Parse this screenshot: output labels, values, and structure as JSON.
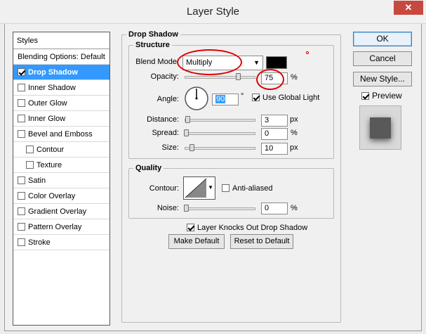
{
  "window": {
    "title": "Layer Style",
    "close_label": "✕"
  },
  "styles_list": {
    "header": "Styles",
    "items": [
      {
        "label": "Blending Options: Default",
        "checkbox": false,
        "checked": false,
        "sub": false,
        "selected": false
      },
      {
        "label": "Drop Shadow",
        "checkbox": true,
        "checked": true,
        "sub": false,
        "selected": true
      },
      {
        "label": "Inner Shadow",
        "checkbox": true,
        "checked": false,
        "sub": false,
        "selected": false
      },
      {
        "label": "Outer Glow",
        "checkbox": true,
        "checked": false,
        "sub": false,
        "selected": false
      },
      {
        "label": "Inner Glow",
        "checkbox": true,
        "checked": false,
        "sub": false,
        "selected": false
      },
      {
        "label": "Bevel and Emboss",
        "checkbox": true,
        "checked": false,
        "sub": false,
        "selected": false
      },
      {
        "label": "Contour",
        "checkbox": true,
        "checked": false,
        "sub": true,
        "selected": false
      },
      {
        "label": "Texture",
        "checkbox": true,
        "checked": false,
        "sub": true,
        "selected": false
      },
      {
        "label": "Satin",
        "checkbox": true,
        "checked": false,
        "sub": false,
        "selected": false
      },
      {
        "label": "Color Overlay",
        "checkbox": true,
        "checked": false,
        "sub": false,
        "selected": false
      },
      {
        "label": "Gradient Overlay",
        "checkbox": true,
        "checked": false,
        "sub": false,
        "selected": false
      },
      {
        "label": "Pattern Overlay",
        "checkbox": true,
        "checked": false,
        "sub": false,
        "selected": false
      },
      {
        "label": "Stroke",
        "checkbox": true,
        "checked": false,
        "sub": false,
        "selected": false
      }
    ]
  },
  "drop_shadow": {
    "title": "Drop Shadow",
    "structure": {
      "title": "Structure",
      "blend_mode_label": "Blend Mode:",
      "blend_mode_value": "Multiply",
      "shadow_color": "#000000",
      "opacity_label": "Opacity:",
      "opacity_value": "75",
      "opacity_unit": "%",
      "angle_label": "Angle:",
      "angle_value": "90",
      "angle_unit": "°",
      "use_global_light_label": "Use Global Light",
      "use_global_light_checked": true,
      "distance_label": "Distance:",
      "distance_value": "3",
      "distance_unit": "px",
      "spread_label": "Spread:",
      "spread_value": "0",
      "spread_unit": "%",
      "size_label": "Size:",
      "size_value": "10",
      "size_unit": "px"
    },
    "quality": {
      "title": "Quality",
      "contour_label": "Contour:",
      "anti_aliased_label": "Anti-aliased",
      "anti_aliased_checked": false,
      "noise_label": "Noise:",
      "noise_value": "0",
      "noise_unit": "%"
    },
    "knocks_out_label": "Layer Knocks Out Drop Shadow",
    "knocks_out_checked": true,
    "make_default_label": "Make Default",
    "reset_default_label": "Reset to Default"
  },
  "buttons": {
    "ok": "OK",
    "cancel": "Cancel",
    "new_style": "New Style...",
    "preview_label": "Preview",
    "preview_checked": true
  },
  "colors": {
    "selection": "#3399ff",
    "annotation": "#e00000",
    "close_button": "#c7483f"
  }
}
